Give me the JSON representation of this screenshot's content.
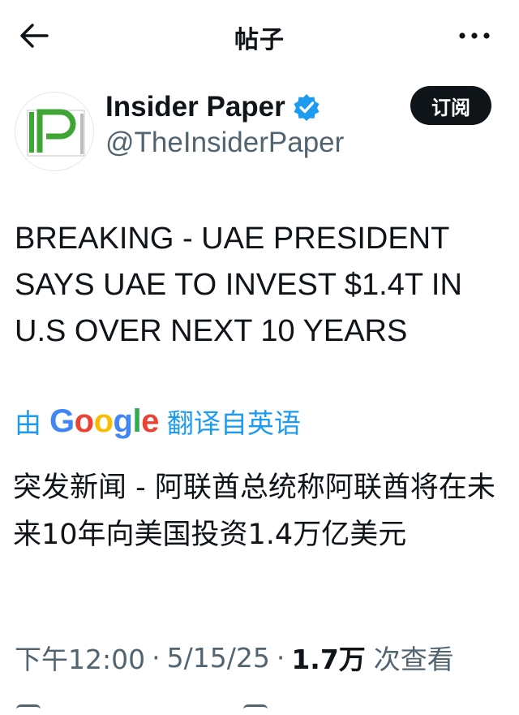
{
  "header": {
    "title": "帖子",
    "back_icon": "back-arrow-icon",
    "more_icon": "more-dots-icon"
  },
  "author": {
    "avatar_text": "IP",
    "name": "Insider Paper",
    "handle": "@TheInsiderPaper",
    "verified_color": "#1d9bf0",
    "subscribe_label": "订阅"
  },
  "tweet": {
    "text": "BREAKING - UAE PRESIDENT SAYS UAE TO INVEST $1.4T IN U.S OVER NEXT 10 YEARS",
    "translate_prefix": "由",
    "translate_suffix": "翻译自英语",
    "translation": "突发新闻 - 阿联酋总统称阿联酋将在未来10年向美国投资1.4万亿美元"
  },
  "meta": {
    "time": "下午12:00",
    "date": "5/15/25",
    "views_count": "1.7万",
    "views_label": "次查看"
  },
  "colors": {
    "accent": "#1d9bf0",
    "text": "#0f1419",
    "secondary": "#536471"
  }
}
